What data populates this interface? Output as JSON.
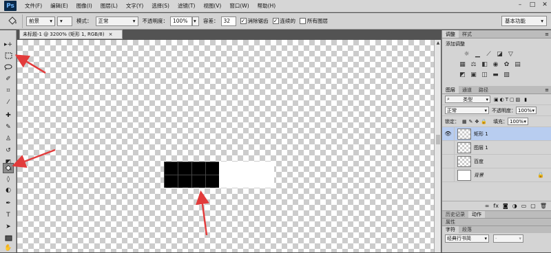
{
  "app": {
    "logo": "Ps"
  },
  "menu": [
    "文件(F)",
    "编辑(E)",
    "图像(I)",
    "图层(L)",
    "文字(Y)",
    "选择(S)",
    "滤镜(T)",
    "视图(V)",
    "窗口(W)",
    "帮助(H)"
  ],
  "window_controls": [
    "–",
    "□",
    "✕"
  ],
  "options": {
    "fill_source": "前景",
    "mode_label": "模式：",
    "mode_value": "正常",
    "opacity_label": "不透明度：",
    "opacity_value": "100%",
    "tolerance_label": "容差：",
    "tolerance_value": "32",
    "antialias_label": "消除锯齿",
    "contiguous_label": "连续的",
    "all_layers_label": "所有图层",
    "workspace": "基本功能"
  },
  "document": {
    "tab_title": "未标题-1 @ 3200% (矩形 1, RGB/8)",
    "close": "×"
  },
  "panels": {
    "adjust_tabs": [
      "调整",
      "样式"
    ],
    "adjust_title": "添加调整",
    "layer_tabs": [
      "图层",
      "通道",
      "路径"
    ],
    "filter_kind": "类型",
    "blend_mode": "正常",
    "opacity_label": "不透明度：",
    "opacity_value": "100%",
    "lock_label": "锁定：",
    "fill_label": "填充：",
    "fill_value": "100%",
    "layers": [
      {
        "name": "矩形 1",
        "visible": true,
        "selected": true
      },
      {
        "name": "图层 1",
        "visible": false,
        "selected": false
      },
      {
        "name": "百度",
        "visible": false,
        "selected": false
      },
      {
        "name": "背景",
        "visible": false,
        "selected": false,
        "locked": true
      }
    ],
    "history_tabs": [
      "历史记录",
      "动作"
    ],
    "props_tabs": [
      "属性"
    ],
    "char_tabs": [
      "字符",
      "段落"
    ],
    "font_family": "经典行书简",
    "font_style": "-"
  },
  "colors": {
    "selected_layer": "#b8cdf0",
    "arrow": "#e23b3b"
  },
  "icons": {
    "tool_icons": [
      "move-icon",
      "marquee-icon",
      "lasso-icon",
      "quick-select-icon",
      "crop-icon",
      "eyedropper-icon",
      "healing-icon",
      "brush-icon",
      "clone-stamp-icon",
      "history-brush-icon",
      "eraser-icon",
      "paint-bucket-icon",
      "blur-icon",
      "dodge-icon",
      "pen-icon",
      "type-icon",
      "path-select-icon",
      "rectangle-icon",
      "hand-icon"
    ]
  }
}
